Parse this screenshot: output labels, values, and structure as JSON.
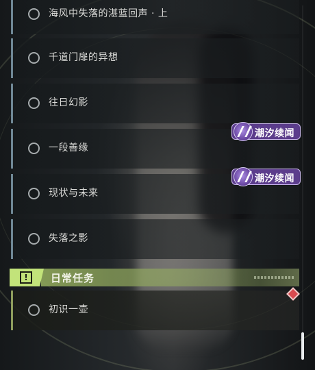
{
  "quests": [
    {
      "label": "海风中失落的湛蓝回声 · 上",
      "icon": "status-circle-icon"
    },
    {
      "label": "千道门扉的异想",
      "icon": "status-circle-icon"
    },
    {
      "label": "往日幻影",
      "icon": "status-circle-icon"
    },
    {
      "label": "一段善缘",
      "icon": "status-circle-icon",
      "tag": "潮汐续闻"
    },
    {
      "label": "现状与未来",
      "icon": "status-circle-icon",
      "tag": "潮汐续闻"
    },
    {
      "label": "失落之影",
      "icon": "status-circle-icon"
    }
  ],
  "daily": {
    "title": "日常任务",
    "icon": "exclamation-icon",
    "accent": "#c2e37a",
    "items": [
      {
        "label": "初识一壶",
        "icon": "status-circle-icon"
      }
    ]
  },
  "tag_color": "#5c3d8c",
  "marker_color": "#d84a4f"
}
